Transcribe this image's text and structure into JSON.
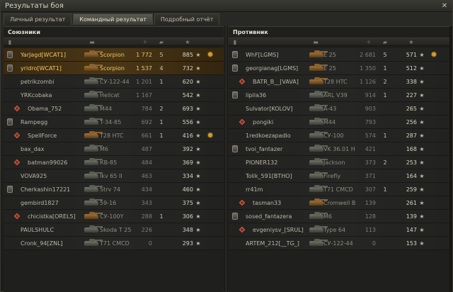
{
  "window": {
    "title": "Результаты боя",
    "close_glyph": "✕"
  },
  "tabs": [
    {
      "label": "Личный результат",
      "active": false
    },
    {
      "label": "Командный результат",
      "active": true
    },
    {
      "label": "Подробный отчёт",
      "active": false
    }
  ],
  "colors": {
    "highlight_row": "#4b3715",
    "highlight_text": "#f0c66a",
    "squad_marker": "#8b2a1e",
    "hero_medal": "#d39b2b"
  },
  "column_icons": [
    "platoon-icon",
    "tank-icon",
    "damage-icon",
    "kills-icon",
    "xp-star-icon"
  ],
  "allies": {
    "title": "Союзники",
    "players": [
      {
        "name": "YarJagd[WCAT1]",
        "tank": "Scorpion",
        "damage": "1 772",
        "kills": "5",
        "xp": "885",
        "platoon": true,
        "squad": false,
        "highlight": true,
        "medal": true,
        "tank_tone": "warm"
      },
      {
        "name": "yridro[WCAT1]",
        "tank": "Scorpion",
        "damage": "1 537",
        "kills": "4",
        "xp": "732",
        "platoon": true,
        "squad": false,
        "highlight": true,
        "medal": false,
        "tank_tone": "warm"
      },
      {
        "name": "petrikzombi",
        "tank": "СУ-122-44",
        "damage": "1 201",
        "kills": "1",
        "xp": "620",
        "platoon": false,
        "squad": false,
        "highlight": false,
        "medal": false,
        "tank_tone": "cool"
      },
      {
        "name": "YRKcobaka",
        "tank": "Hellcat",
        "damage": "1 167",
        "kills": "",
        "xp": "542",
        "platoon": false,
        "squad": false,
        "highlight": false,
        "medal": false,
        "tank_tone": "cool"
      },
      {
        "name": "Obama_752",
        "tank": "M44",
        "damage": "784",
        "kills": "2",
        "xp": "693",
        "platoon": false,
        "squad": true,
        "highlight": false,
        "medal": false,
        "tank_tone": "cool"
      },
      {
        "name": "Rampegg",
        "tank": "T-34-85",
        "damage": "692",
        "kills": "1",
        "xp": "556",
        "platoon": true,
        "squad": false,
        "highlight": false,
        "medal": false,
        "tank_tone": "cool"
      },
      {
        "name": "SpellForce",
        "tank": "T28 HTC",
        "damage": "661",
        "kills": "1",
        "xp": "416",
        "platoon": false,
        "squad": true,
        "highlight": false,
        "medal": true,
        "tank_tone": "warm"
      },
      {
        "name": "bax_dax",
        "tank": "M6",
        "damage": "487",
        "kills": "",
        "xp": "392",
        "platoon": false,
        "squad": false,
        "highlight": false,
        "medal": false,
        "tank_tone": "cool"
      },
      {
        "name": "batman99026",
        "tank": "КВ-85",
        "damage": "484",
        "kills": "",
        "xp": "369",
        "platoon": false,
        "squad": true,
        "highlight": false,
        "medal": false,
        "tank_tone": "cool"
      },
      {
        "name": "VOVA925",
        "tank": "Ikv 65 II",
        "damage": "463",
        "kills": "",
        "xp": "334",
        "platoon": false,
        "squad": false,
        "highlight": false,
        "medal": false,
        "tank_tone": "cool"
      },
      {
        "name": "Cherkashin17221",
        "tank": "Strv 74",
        "damage": "434",
        "kills": "",
        "xp": "460",
        "platoon": true,
        "squad": false,
        "highlight": false,
        "medal": false,
        "tank_tone": "cool"
      },
      {
        "name": "gembird1827",
        "tank": "59-16",
        "damage": "343",
        "kills": "",
        "xp": "375",
        "platoon": false,
        "squad": false,
        "highlight": false,
        "medal": false,
        "tank_tone": "cool"
      },
      {
        "name": "chicistka[OREL5]",
        "tank": "СУ-100Y",
        "damage": "288",
        "kills": "1",
        "xp": "306",
        "platoon": false,
        "squad": true,
        "highlight": false,
        "medal": false,
        "tank_tone": "warm"
      },
      {
        "name": "PAULSHULC",
        "tank": "Skoda T 25",
        "damage": "226",
        "kills": "",
        "xp": "348",
        "platoon": false,
        "squad": false,
        "highlight": false,
        "medal": false,
        "tank_tone": "cool"
      },
      {
        "name": "Cronk_94[ZNL]",
        "tank": "T71 CMCD",
        "damage": "0",
        "kills": "",
        "xp": "293",
        "platoon": false,
        "squad": false,
        "highlight": false,
        "medal": false,
        "tank_tone": "cool"
      }
    ]
  },
  "enemies": {
    "title": "Противник",
    "players": [
      {
        "name": "WhF[LGMS]",
        "tank": "E 25",
        "damage": "2 681",
        "kills": "5",
        "xp": "571",
        "platoon": true,
        "squad": false,
        "highlight": false,
        "medal": true,
        "tank_tone": "warm"
      },
      {
        "name": "georgianag[LGMS]",
        "tank": "E 25",
        "damage": "1 350",
        "kills": "1",
        "xp": "512",
        "platoon": true,
        "squad": false,
        "highlight": false,
        "medal": false,
        "tank_tone": "warm"
      },
      {
        "name": "BATR_B__[VAVA]",
        "tank": "T28 HTC",
        "damage": "1 126",
        "kills": "2",
        "xp": "338",
        "platoon": false,
        "squad": true,
        "highlight": false,
        "medal": false,
        "tank_tone": "warm"
      },
      {
        "name": "lipila36",
        "tank": "ARL V39",
        "damage": "914",
        "kills": "1",
        "xp": "227",
        "platoon": true,
        "squad": false,
        "highlight": false,
        "medal": false,
        "tank_tone": "cool"
      },
      {
        "name": "Sulvator[KOLOV]",
        "tank": "A-43",
        "damage": "903",
        "kills": "",
        "xp": "265",
        "platoon": false,
        "squad": false,
        "highlight": false,
        "medal": false,
        "tank_tone": "cool"
      },
      {
        "name": "pongiki",
        "tank": "M44",
        "damage": "793",
        "kills": "",
        "xp": "256",
        "platoon": false,
        "squad": true,
        "highlight": false,
        "medal": false,
        "tank_tone": "cool"
      },
      {
        "name": "1redkoezapadlo",
        "tank": "СУ-100",
        "damage": "574",
        "kills": "1",
        "xp": "287",
        "platoon": false,
        "squad": false,
        "highlight": false,
        "medal": false,
        "tank_tone": "cool"
      },
      {
        "name": "tvoi_fantazer",
        "tank": "VK 36.01 H",
        "damage": "421",
        "kills": "",
        "xp": "168",
        "platoon": true,
        "squad": false,
        "highlight": false,
        "medal": false,
        "tank_tone": "cool"
      },
      {
        "name": "PIONER132",
        "tank": "Jackson",
        "damage": "373",
        "kills": "2",
        "xp": "253",
        "platoon": false,
        "squad": false,
        "highlight": false,
        "medal": false,
        "tank_tone": "cool"
      },
      {
        "name": "Tolik_591[BTHO]",
        "tank": "Firefly",
        "damage": "371",
        "kills": "",
        "xp": "164",
        "platoon": false,
        "squad": false,
        "highlight": false,
        "medal": false,
        "tank_tone": "cool"
      },
      {
        "name": "rr41m",
        "tank": "T71 CMCD",
        "damage": "307",
        "kills": "1",
        "xp": "259",
        "platoon": false,
        "squad": false,
        "highlight": false,
        "medal": false,
        "tank_tone": "cool"
      },
      {
        "name": "tasman33",
        "tank": "Cromwell B",
        "damage": "139",
        "kills": "",
        "xp": "261",
        "platoon": false,
        "squad": true,
        "highlight": false,
        "medal": false,
        "tank_tone": "warm"
      },
      {
        "name": "sosed_fantazera",
        "tank": "M6",
        "damage": "128",
        "kills": "",
        "xp": "139",
        "platoon": true,
        "squad": false,
        "highlight": false,
        "medal": false,
        "tank_tone": "cool"
      },
      {
        "name": "evgeniysv_[SRUL]",
        "tank": "Type 64",
        "damage": "113",
        "kills": "",
        "xp": "147",
        "platoon": false,
        "squad": true,
        "highlight": false,
        "medal": false,
        "tank_tone": "cool"
      },
      {
        "name": "ARTEM_212[__TG_]",
        "tank": "СУ-122-44",
        "damage": "0",
        "kills": "",
        "xp": "153",
        "platoon": false,
        "squad": false,
        "highlight": false,
        "medal": false,
        "tank_tone": "cool"
      }
    ]
  }
}
